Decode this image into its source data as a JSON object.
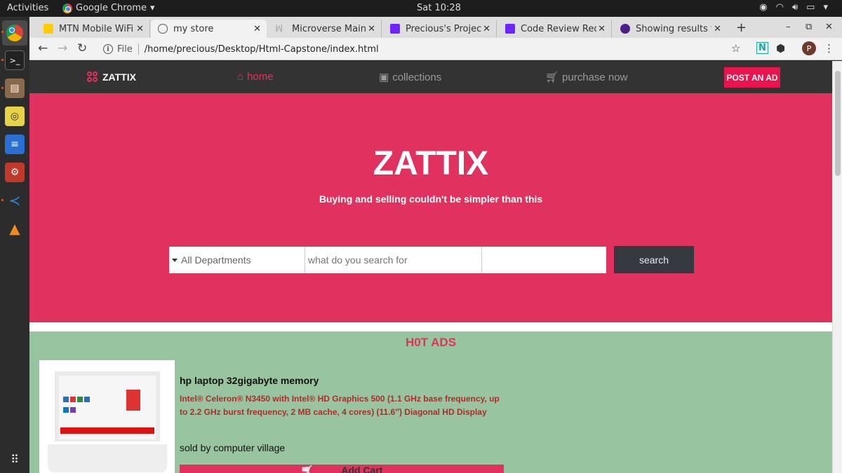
{
  "system": {
    "activities": "Activities",
    "app_name": "Google Chrome",
    "clock": "Sat 10:28"
  },
  "tabs": [
    {
      "title": "MTN Mobile WiFi",
      "icon": "mtn-icon",
      "color": "#ffcc00"
    },
    {
      "title": "my store",
      "icon": "globe-icon",
      "color": "#555555"
    },
    {
      "title": "Microverse Main C",
      "icon": "microverse-icon",
      "color": "#6f23ff"
    },
    {
      "title": "Precious's Project",
      "icon": "microverse-icon",
      "color": "#6f23ff"
    },
    {
      "title": "Code Review Requ",
      "icon": "microverse-icon",
      "color": "#6f23ff"
    },
    {
      "title": "Showing results f",
      "icon": "github-icon",
      "color": "#4b1f8a"
    }
  ],
  "address_bar": {
    "scheme_label": "File",
    "url": "/home/precious/Desktop/Html-Capstone/index.html"
  },
  "profile_initial": "P",
  "site": {
    "brand": "ZATTIX",
    "nav": {
      "home": "home",
      "collections": "collections",
      "purchase": "purchase now",
      "post_ad": "POST AN AD"
    },
    "hero": {
      "title": "ZATTIX",
      "tagline": "Buying and selling couldn't be simpler than this"
    },
    "search": {
      "department": "All Departments",
      "placeholder": "what do you search for",
      "button": "search"
    },
    "hot_ads": {
      "heading": "H0T ADS",
      "product": {
        "title": "hp laptop 32gigabyte memory",
        "description": "Intel® Celeron® N3450 with Intel® HD Graphics 500 (1.1 GHz base frequency, up to 2.2 GHz burst frequency, 2 MB cache, 4 cores) (11.6″) Diagonal HD Display",
        "seller": "sold by computer village",
        "cart_button": "Add Cart"
      }
    }
  },
  "colors": {
    "accent": "#e0315f",
    "nav_bg": "#333333",
    "hot_bg": "#98c59f",
    "post_btn": "#e9134e"
  }
}
